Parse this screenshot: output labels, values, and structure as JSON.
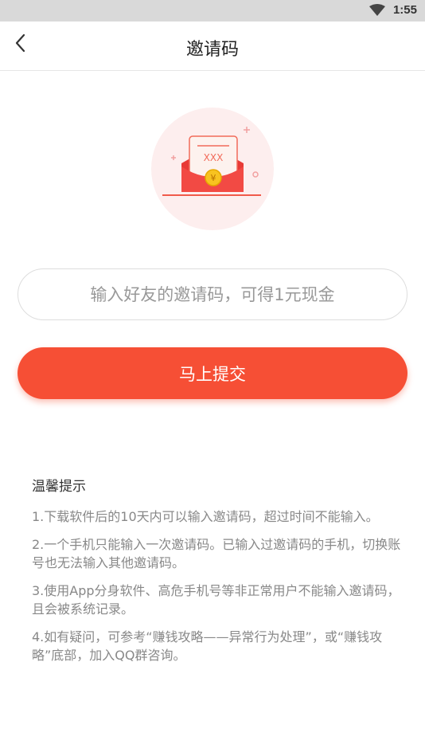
{
  "status_bar": {
    "time": "1:55",
    "wifi_icon": "wifi-icon"
  },
  "nav": {
    "back_icon": "back-arrow-icon",
    "title": "邀请码"
  },
  "hero": {
    "icon": "red-envelope-icon",
    "envelope_text": "XXX",
    "coin_text": "¥"
  },
  "invite_input": {
    "placeholder": "输入好友的邀请码，可得1元现金",
    "value": ""
  },
  "submit_label": "马上提交",
  "tips": {
    "title": "温馨提示",
    "items": [
      "1.下载软件后的10天内可以输入邀请码，超过时间不能输入。",
      "2.一个手机只能输入一次邀请码。已输入过邀请码的手机，切换账号也无法输入其他邀请码。",
      "3.使用App分身软件、高危手机号等非正常用户不能输入邀请码，且会被系统记录。",
      "4.如有疑问，可参考“赚钱攻略——异常行为处理”，或“赚钱攻略”底部，加入QQ群咨询。"
    ]
  },
  "colors": {
    "accent": "#f64f35",
    "status_bar": "#d9d9d9",
    "tip_text": "#888888"
  }
}
